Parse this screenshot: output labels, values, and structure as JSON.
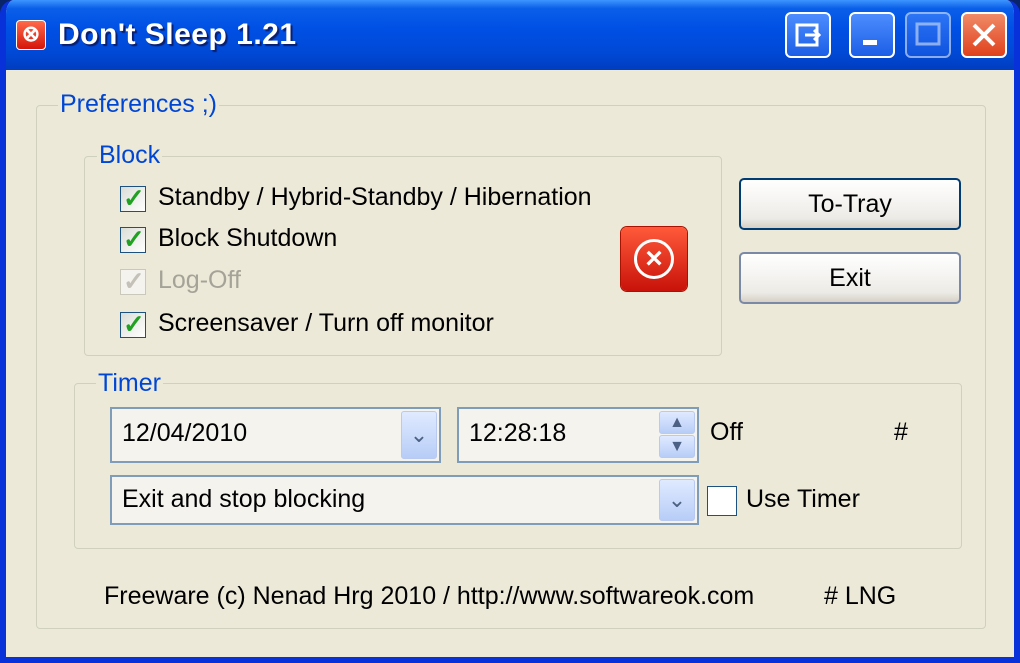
{
  "window": {
    "title": "Don't Sleep 1.21"
  },
  "preferences": {
    "label": "Preferences ;)"
  },
  "block": {
    "label": "Block",
    "items": [
      {
        "label": "Standby / Hybrid-Standby / Hibernation",
        "checked": true,
        "enabled": true
      },
      {
        "label": "Block Shutdown",
        "checked": true,
        "enabled": true
      },
      {
        "label": "Log-Off",
        "checked": true,
        "enabled": false
      },
      {
        "label": "Screensaver / Turn off monitor",
        "checked": true,
        "enabled": true
      }
    ]
  },
  "buttons": {
    "to_tray": "To-Tray",
    "exit": "Exit"
  },
  "timer": {
    "label": "Timer",
    "date": "12/04/2010",
    "time": "12:28:18",
    "status": "Off",
    "hash": "#",
    "action": "Exit and stop blocking",
    "use_timer_label": "Use Timer",
    "use_timer_checked": false
  },
  "footer": {
    "credit": "Freeware (c) Nenad Hrg 2010 / http://www.softwareok.com",
    "lng": "# LNG"
  }
}
